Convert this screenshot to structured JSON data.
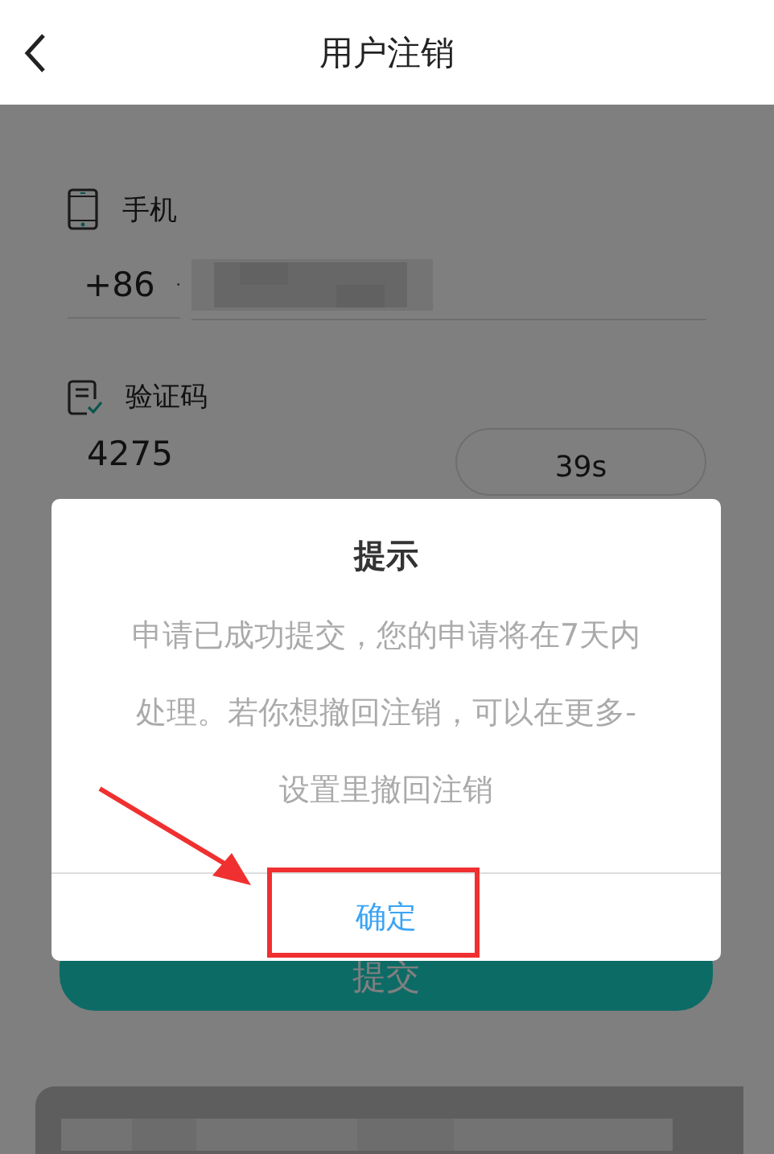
{
  "header": {
    "title": "用户注销"
  },
  "form": {
    "phone": {
      "label": "手机",
      "country_code": "+86"
    },
    "code": {
      "label": "验证码",
      "value": "4275",
      "countdown": "39s"
    },
    "submit": "提交"
  },
  "dialog": {
    "title": "提示",
    "message": "申请已成功提交，您的申请将在7天内处理。若你想撤回注销，可以在更多-设置里撤回注销",
    "confirm": "确定"
  }
}
